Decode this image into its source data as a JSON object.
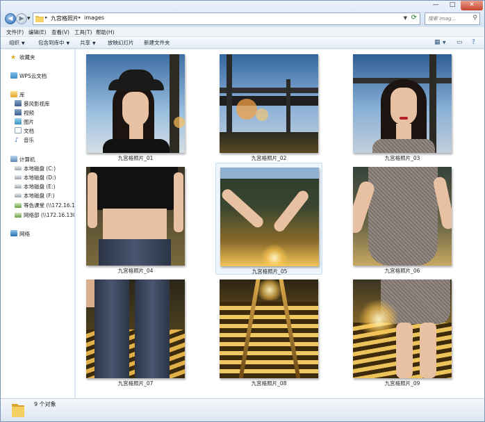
{
  "window": {
    "breadcrumbs": [
      "九宫格照片",
      "images"
    ],
    "search_placeholder": "搜索 imag...",
    "controls": {
      "minimize": "—",
      "maximize": "□",
      "close": "✕"
    }
  },
  "menu": {
    "items": [
      "文件(F)",
      "编辑(E)",
      "查看(V)",
      "工具(T)",
      "帮助(H)"
    ]
  },
  "toolbar": {
    "items": [
      "组织",
      "包含到库中",
      "共享",
      "放映幻灯片",
      "新建文件夹"
    ]
  },
  "navpane": {
    "favorites": "收藏夹",
    "wps": "WPS云文档",
    "library": "库",
    "library_items": [
      "暴风影视库",
      "视频",
      "图片",
      "文档",
      "音乐"
    ],
    "computer": "计算机",
    "drives": [
      "本地磁盘 (C:)",
      "本地磁盘 (D:)",
      "本地磁盘 (E:)",
      "本地磁盘 (F:)",
      "等色课堂 (\\\\172.16.130",
      "网络部 (\\\\172.16.130.1"
    ],
    "network": "网络"
  },
  "files": [
    {
      "name": "九宫格照片_01",
      "selected": false
    },
    {
      "name": "九宫格照片_02",
      "selected": false
    },
    {
      "name": "九宫格照片_03",
      "selected": false
    },
    {
      "name": "九宫格照片_04",
      "selected": false
    },
    {
      "name": "九宫格照片_05",
      "selected": true
    },
    {
      "name": "九宫格照片_06",
      "selected": false
    },
    {
      "name": "九宫格照片_07",
      "selected": false
    },
    {
      "name": "九宫格照片_08",
      "selected": false
    },
    {
      "name": "九宫格照片_09",
      "selected": false
    }
  ],
  "status": {
    "count_text": "9 个对象"
  },
  "colors": {
    "selection": "#eef5fc",
    "chrome": "#dfeaf6",
    "accent": "#2d6cb5"
  }
}
